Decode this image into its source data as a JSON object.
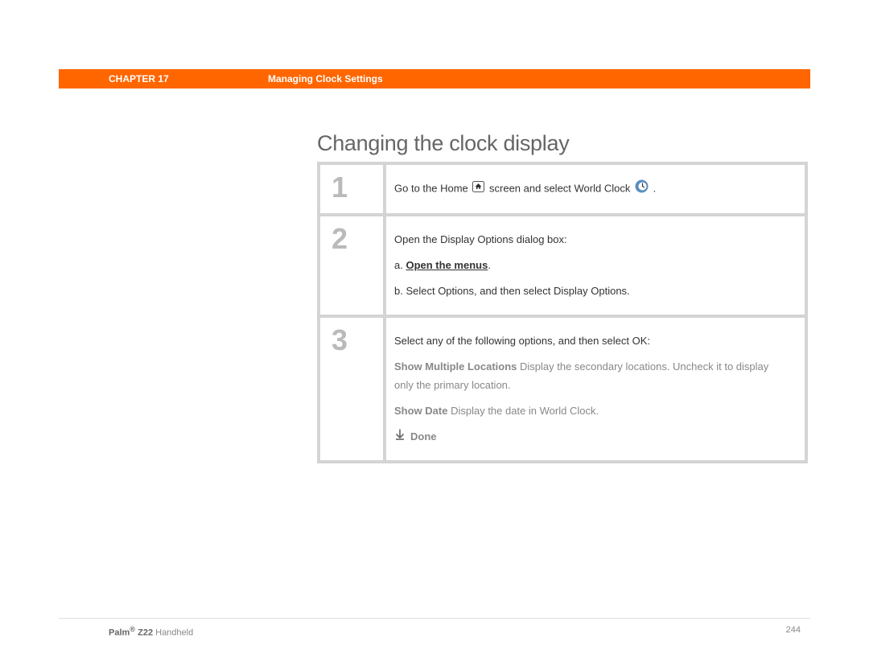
{
  "header": {
    "chapter": "CHAPTER 17",
    "title": "Managing Clock Settings"
  },
  "heading": "Changing the clock display",
  "steps": [
    {
      "num": "1",
      "line1a": "Go to the Home ",
      "line1b": " screen and select World Clock ",
      "line1c": " ."
    },
    {
      "num": "2",
      "line1": "Open the Display Options dialog box:",
      "a_pre": "a.  ",
      "a_link": "Open the menus",
      "a_post": ".",
      "b": "b.  Select Options, and then select Display Options."
    },
    {
      "num": "3",
      "line1": "Select any of the following options, and then select OK:",
      "opt1_bold": "Show Multiple Locations",
      "opt1_rest": "   Display the secondary locations. Uncheck it to display only the primary location.",
      "opt2_bold": "Show Date",
      "opt2_rest": "   Display the date in World Clock.",
      "done": "Done"
    }
  ],
  "footer": {
    "brand": "Palm",
    "reg": "®",
    "model": " Z22",
    "suffix": " Handheld",
    "page": "244"
  }
}
